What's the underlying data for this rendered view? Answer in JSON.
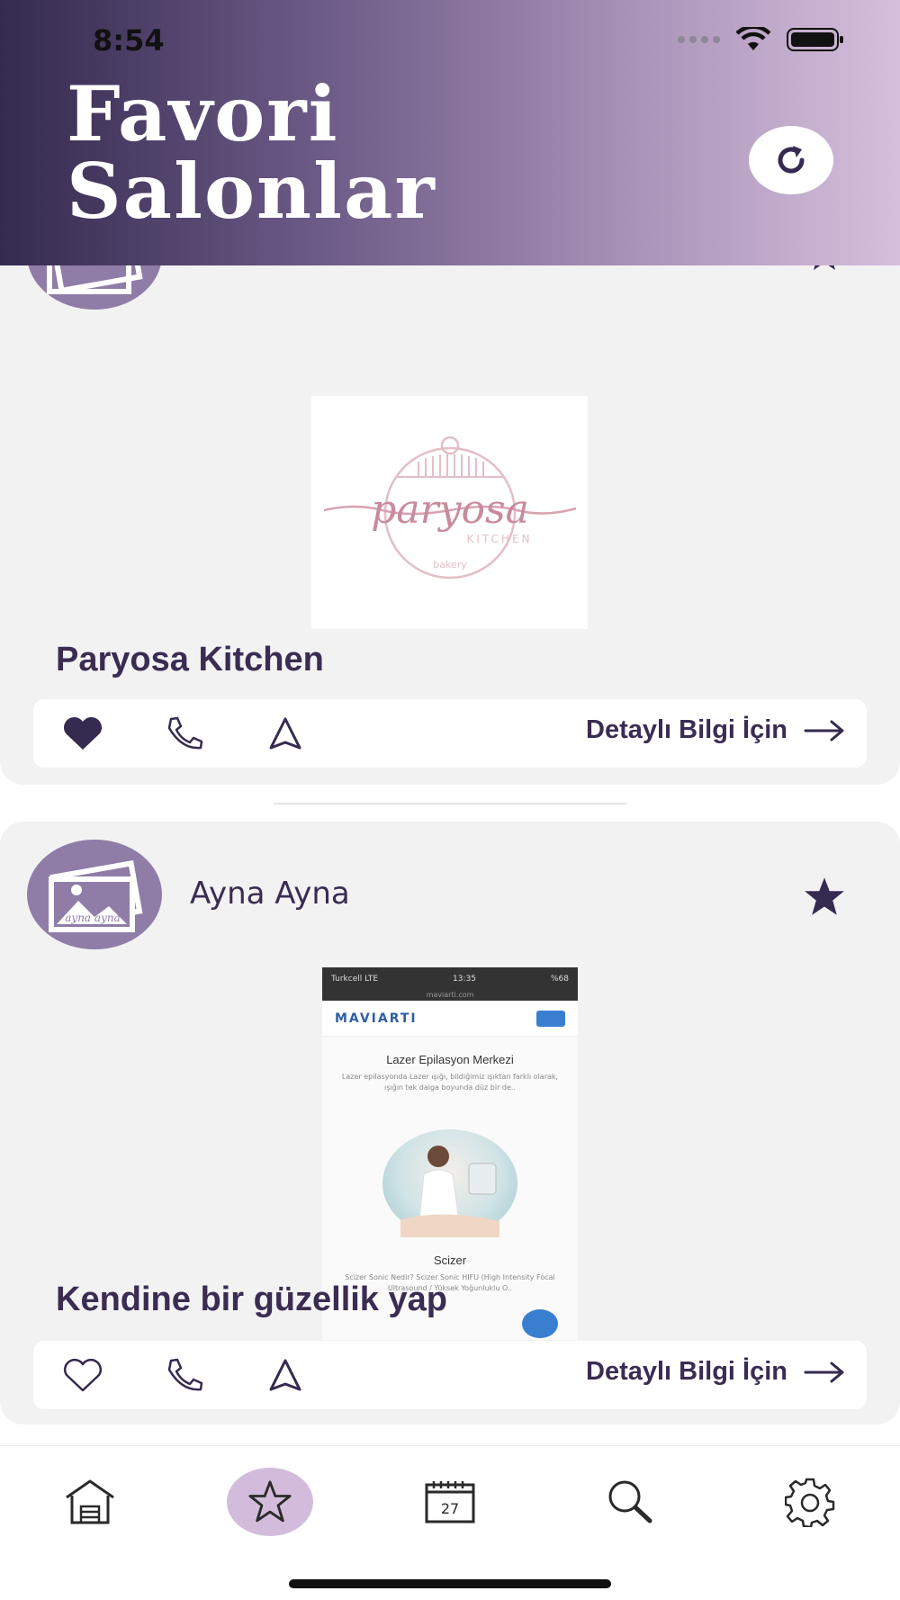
{
  "status_bar": {
    "time": "8:54"
  },
  "header": {
    "title_line1": "Favori",
    "title_line2": "Salonlar",
    "refresh_icon": "refresh-icon"
  },
  "cards": [
    {
      "logo_text": "paryosa",
      "logo_sub1": "KITCHEN",
      "logo_sub2": "bakery",
      "title": "Paryosa Kitchen",
      "favorited": true,
      "details_label": "Detaylı Bilgi İçin"
    },
    {
      "salon_name": "Ayna Ayna",
      "avatar_text": "ayna ayna",
      "cover": {
        "carrier": "Turkcell LTE",
        "time": "13:35",
        "battery": "%68",
        "url": "maviarti.com",
        "brand": "MAVIARTI",
        "heading1": "Lazer Epilasyon Merkezi",
        "text1": "Lazer epilasyonda Lazer ışığı, bildiğimiz ışıktan farklı olarak, ışığın tek dalga boyunda düz bir de..",
        "heading2": "Scizer",
        "text2": "Scizer Sonic Nedir? Scizer Sonic HIFU (High Intensity Focal Ultrasound / Yüksek Yoğunluklu O.."
      },
      "title": "Kendine bir güzellik yap",
      "favorited": false,
      "details_label": "Detaylı Bilgi İçin"
    }
  ],
  "bottom_nav": {
    "items": [
      "home-icon",
      "star-icon",
      "calendar-icon",
      "search-icon",
      "settings-icon"
    ],
    "active": "star-icon",
    "calendar_day": "27"
  },
  "colors": {
    "primary": "#3a2c52",
    "active_tab": "#d3bcdb",
    "avatar": "#8f7da8",
    "card_bg": "#f2f2f3"
  }
}
